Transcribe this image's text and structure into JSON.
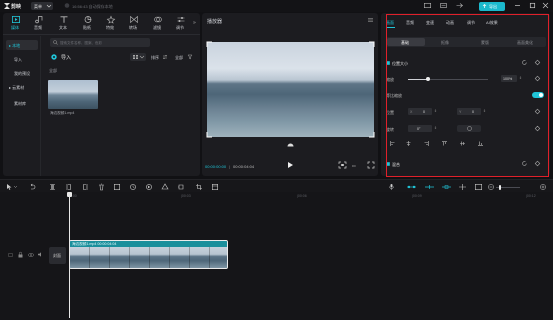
{
  "app": {
    "brand": "剪映",
    "menu_label": "菜单",
    "autosave_text": "16:56:43 自动保存本地",
    "export_label": "导出"
  },
  "top_tools": [
    {
      "label": "媒体",
      "icon": "media-icon"
    },
    {
      "label": "音频",
      "icon": "audio-icon"
    },
    {
      "label": "文本",
      "icon": "text-icon"
    },
    {
      "label": "贴纸",
      "icon": "sticker-icon"
    },
    {
      "label": "特效",
      "icon": "effects-icon"
    },
    {
      "label": "转场",
      "icon": "transition-icon"
    },
    {
      "label": "滤镜",
      "icon": "filter-icon"
    },
    {
      "label": "调节",
      "icon": "adjust-icon"
    }
  ],
  "media_sidebar": {
    "items": [
      "本地",
      "导入",
      "我的预设",
      "云素材",
      "素材库"
    ]
  },
  "media_panel": {
    "search_placeholder": "搜索文件名称、图案、色彩",
    "import_label": "导入",
    "sort_label": "排序",
    "filter_label": "全部",
    "section_label": "全部",
    "clip_name": "海边视频1.mp4"
  },
  "player": {
    "title": "播放器",
    "current_time": "00:00:00:00",
    "total_time": "00:00:04:04"
  },
  "inspector": {
    "tabs": [
      "画面",
      "音频",
      "变速",
      "动画",
      "调节",
      "AI效果"
    ],
    "subtabs": [
      "基础",
      "抠像",
      "蒙版",
      "画面美化"
    ],
    "position_size_label": "位置大小",
    "scale_label": "缩放",
    "scale_value": "100%",
    "scale_level": 0.25,
    "uniform_scale_label": "等比缩放",
    "position_label": "位置",
    "x_label": "X",
    "x_value": "0",
    "y_label": "Y",
    "y_value": "0",
    "rotate_label": "旋转",
    "rotate_value": "0°",
    "blend_label": "混合",
    "highlight_color": "#e0202a"
  },
  "timeline": {
    "ruler_marks": [
      "00:00",
      "|00:03",
      "|00:06",
      "|00:09",
      "|00:12"
    ],
    "cover_label": "封面",
    "clip_title": "海边视频1.mp4  00:00:04:04"
  },
  "colors": {
    "accent": "#20c5d8",
    "background": "#111114",
    "panel": "#1c1c20"
  }
}
